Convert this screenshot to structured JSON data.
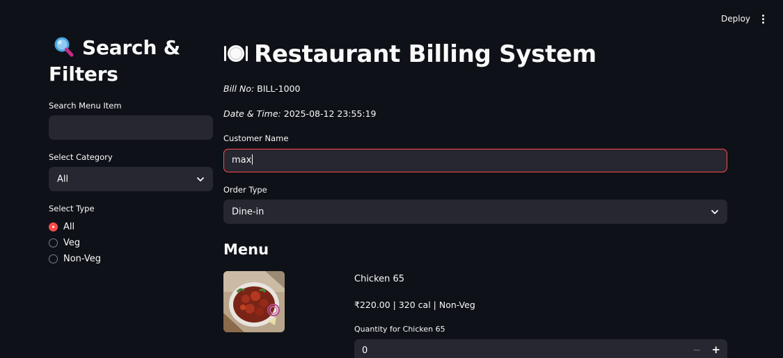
{
  "header": {
    "deploy_label": "Deploy"
  },
  "sidebar": {
    "title": "Search & Filters",
    "search": {
      "label": "Search Menu Item",
      "value": "",
      "placeholder": ""
    },
    "category": {
      "label": "Select Category",
      "selected": "All"
    },
    "type": {
      "label": "Select Type",
      "options": [
        "All",
        "Veg",
        "Non-Veg"
      ],
      "selected": "All"
    }
  },
  "main": {
    "title": "Restaurant Billing System",
    "bill_no_label": "Bill No:",
    "bill_no": "BILL-1000",
    "datetime_label": "Date & Time:",
    "datetime": "2025-08-12 23:55:19",
    "customer": {
      "label": "Customer Name",
      "value": "max"
    },
    "order_type": {
      "label": "Order Type",
      "selected": "Dine-in"
    },
    "menu": {
      "heading": "Menu",
      "items": [
        {
          "name": "Chicken 65",
          "meta": "₹220.00 | 320 cal | Non-Veg",
          "qty_label": "Quantity for Chicken 65",
          "qty": "0"
        }
      ]
    }
  },
  "colors": {
    "background": "#0e1117",
    "input_bg": "#262730",
    "accent": "#ff4b4b",
    "text": "#fafafa"
  },
  "icons": {
    "title_icon": "magnifying-glass-icon",
    "main_icon": "plate-cutlery-icon",
    "menu_icon": "kebab-menu-icon",
    "chevron": "chevron-down-icon"
  }
}
